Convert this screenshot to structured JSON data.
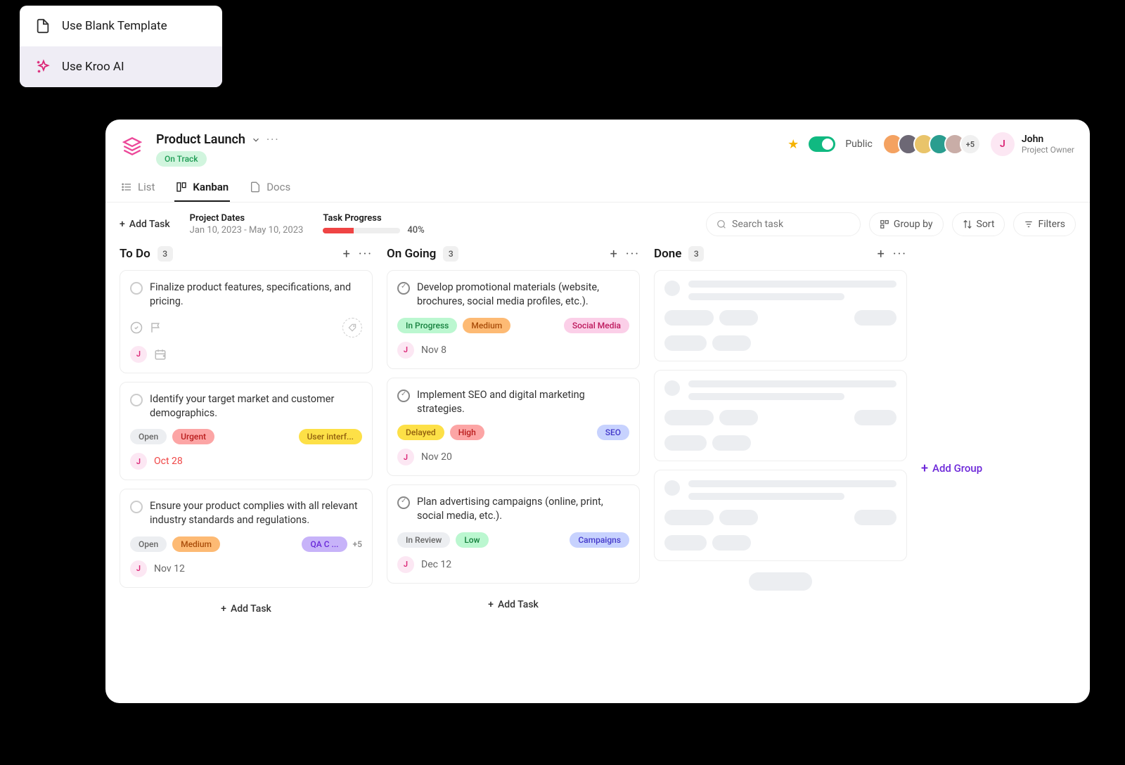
{
  "template_menu": {
    "blank": "Use Blank Template",
    "ai": "Use Kroo AI"
  },
  "project": {
    "title": "Product Launch",
    "status": "On Track"
  },
  "owner": {
    "initial": "J",
    "name": "John",
    "role": "Project Owner"
  },
  "public_label": "Public",
  "avatars_more": "+5",
  "tabs": {
    "list": "List",
    "kanban": "Kanban",
    "docs": "Docs"
  },
  "toolbar": {
    "add_task": "Add Task",
    "project_dates_label": "Project Dates",
    "project_dates_value": "Jan 10, 2023 - May 10, 2023",
    "task_progress_label": "Task Progress",
    "task_progress_pct": "40%",
    "search_placeholder": "Search task",
    "group_by": "Group by",
    "sort": "Sort",
    "filters": "Filters"
  },
  "columns": {
    "todo": {
      "title": "To Do",
      "count": "3"
    },
    "ongoing": {
      "title": "On Going",
      "count": "3"
    },
    "done": {
      "title": "Done",
      "count": "3"
    }
  },
  "tasks": {
    "t1": {
      "title": "Finalize product features, specifications, and pricing.",
      "assignee": "J"
    },
    "t2": {
      "title": "Identify your target market and customer demographics.",
      "status": "Open",
      "priority": "Urgent",
      "tag": "User interf...",
      "assignee": "J",
      "date": "Oct 28"
    },
    "t3": {
      "title": "Ensure your product complies with all relevant industry standards and regulations.",
      "status": "Open",
      "priority": "Medium",
      "tag": "QA C ...",
      "more": "+5",
      "assignee": "J",
      "date": "Nov 12"
    },
    "t4": {
      "title": "Develop promotional materials (website, brochures, social media profiles, etc.).",
      "status": "In Progress",
      "priority": "Medium",
      "tag": "Social Media",
      "assignee": "J",
      "date": "Nov 8"
    },
    "t5": {
      "title": "Implement SEO and digital marketing strategies.",
      "status": "Delayed",
      "priority": "High",
      "tag": "SEO",
      "assignee": "J",
      "date": "Nov 20"
    },
    "t6": {
      "title": "Plan advertising campaigns (online, print, social media, etc.).",
      "status": "In Review",
      "priority": "Low",
      "tag": "Campaigns",
      "assignee": "J",
      "date": "Dec 12"
    }
  },
  "add_task_col": "Add Task",
  "add_group": "Add Group"
}
